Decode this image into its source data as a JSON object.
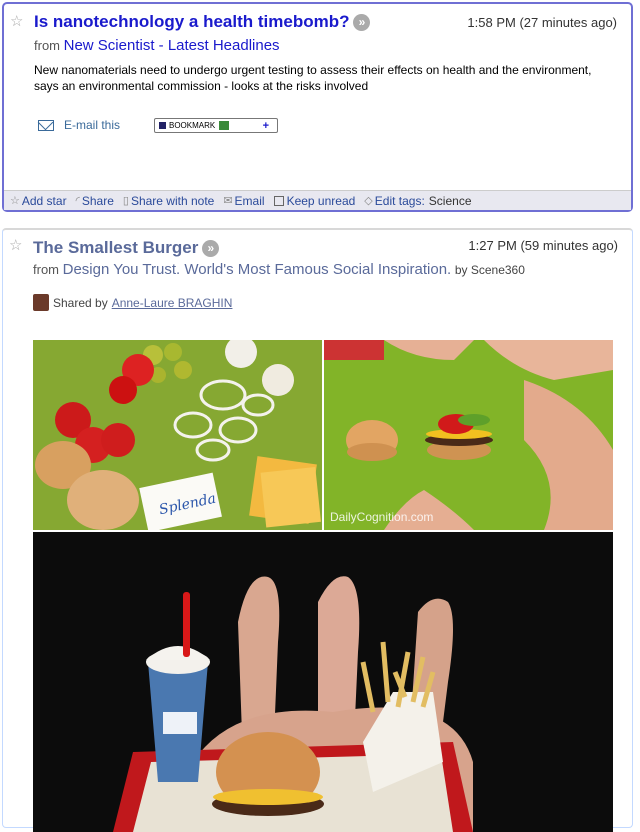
{
  "entries": [
    {
      "title": "Is nanotechnology a health timebomb?",
      "time": "1:58 PM (27 minutes ago)",
      "from_label": "from",
      "source": "New Scientist - Latest Headlines",
      "snippet": "New nanomaterials need to undergo urgent testing to assess their effects on health and the environment, says an environmental commission - looks at the risks involved",
      "email_this": "E-mail this",
      "bookmark_label": "BOOKMARK",
      "actions": {
        "add_star": "Add star",
        "share": "Share",
        "share_with_note": "Share with note",
        "email": "Email",
        "keep_unread": "Keep unread",
        "edit_tags": "Edit tags:",
        "tag_value": "Science"
      }
    },
    {
      "title": "The Smallest Burger",
      "time": "1:27 PM (59 minutes ago)",
      "from_label": "from",
      "source": "Design You Trust. World's Most Famous Social Inspiration.",
      "by": "by Scene360",
      "shared_by_label": "Shared by",
      "shared_by_name": "Anne-Laure BRAGHIN",
      "watermark": "DailyCognition.com"
    }
  ],
  "colors": {
    "selected_border": "#6f6fd4",
    "title_link": "#1a1acc",
    "title_read": "#5a6a9a"
  }
}
